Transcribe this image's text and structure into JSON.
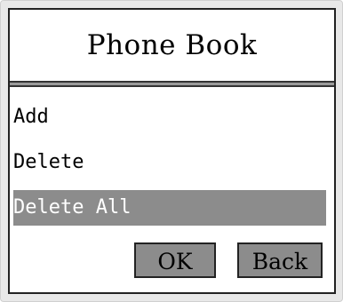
{
  "window": {
    "title": "Phone Book"
  },
  "menu": {
    "items": [
      {
        "label": "Add",
        "selected": false
      },
      {
        "label": "Delete",
        "selected": false
      },
      {
        "label": "Delete All",
        "selected": true
      }
    ]
  },
  "buttons": {
    "ok_label": "OK",
    "back_label": "Back"
  },
  "colors": {
    "highlight": "#8c8c8c",
    "frame": "#222222",
    "background": "#ffffff"
  }
}
